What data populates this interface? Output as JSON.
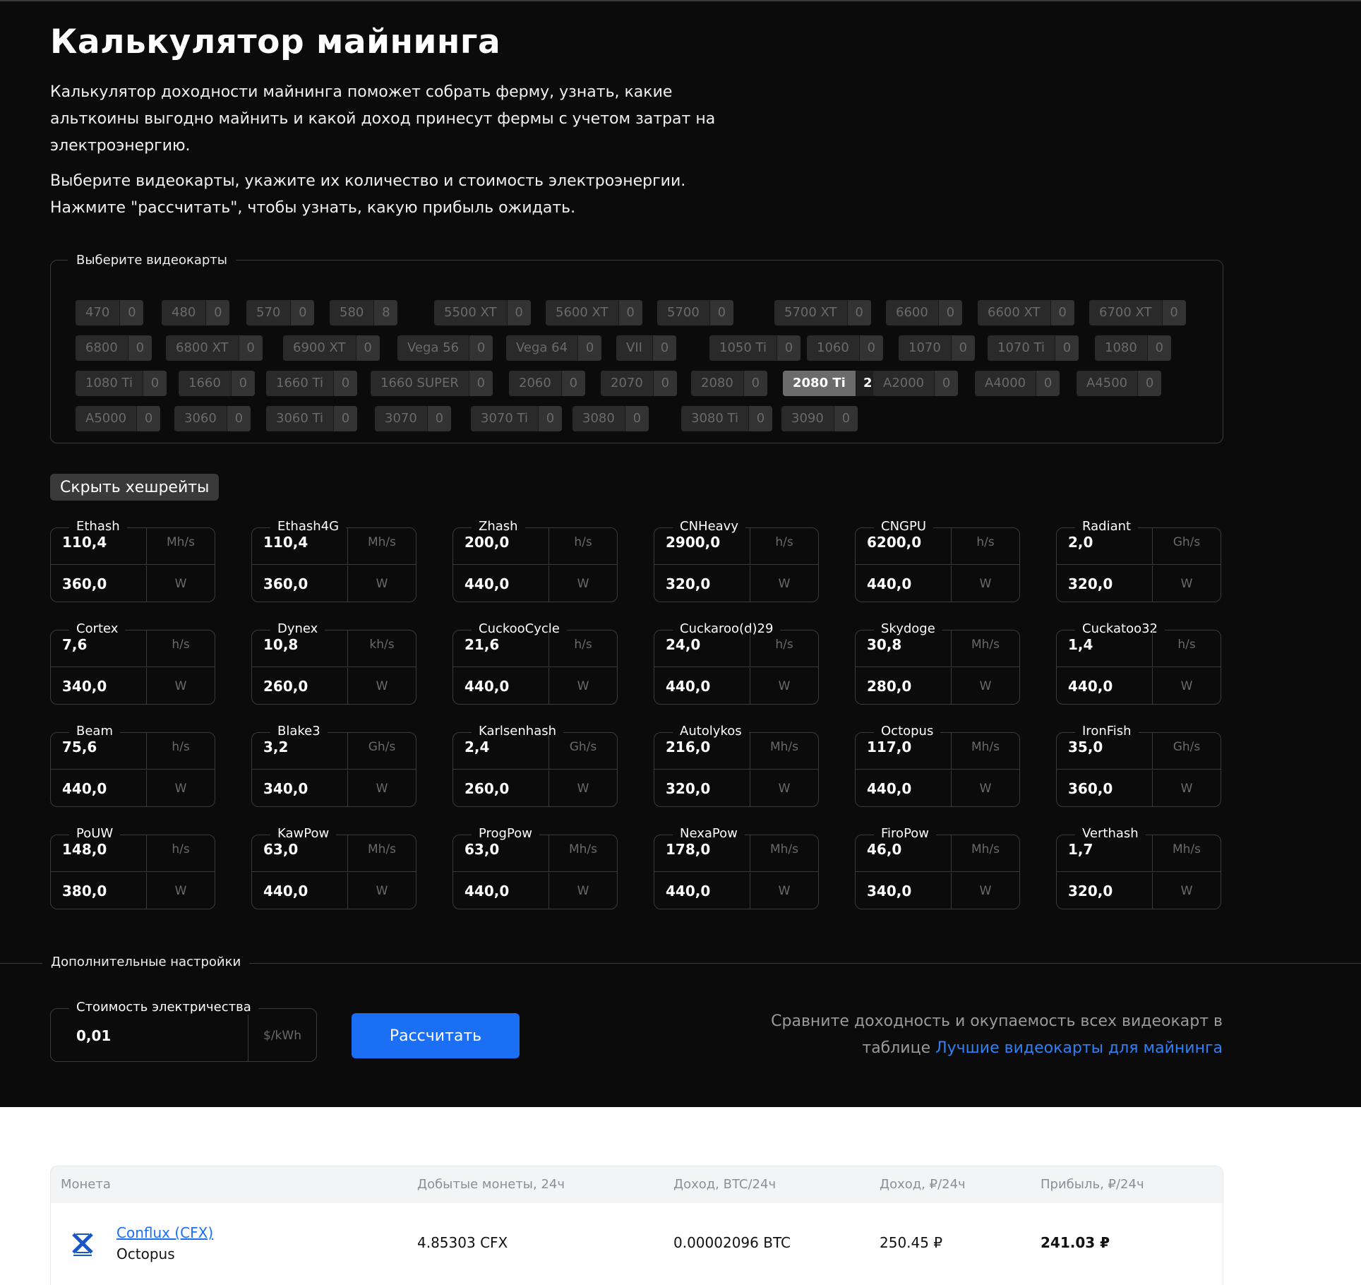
{
  "page": {
    "title": "Калькулятор майнинга",
    "intro_1": "Калькулятор доходности майнинга поможет собрать ферму, узнать, какие альткоины выгодно майнить и какой доход принесут фермы с учетом затрат на электроэнергию.",
    "intro_2": "Выберите видеокарты, укажите их количество и стоимость электроэнергии. Нажмите \"рассчитать\", чтобы узнать, какую прибыль ожидать."
  },
  "cards_section": {
    "legend": "Выберите видеокарты",
    "rows": [
      [
        [
          "470",
          "0"
        ],
        [
          "480",
          "0"
        ],
        [
          "570",
          "0"
        ],
        [
          "580",
          "8"
        ],
        [
          "5500 XT",
          "0"
        ],
        [
          "5600 XT",
          "0"
        ],
        [
          "5700",
          "0"
        ],
        [
          "5700 XT",
          "0"
        ],
        [
          "6600",
          "0"
        ],
        [
          "6600 XT",
          "0"
        ],
        [
          "6700 XT",
          "0"
        ]
      ],
      [
        [
          "6800",
          "0"
        ],
        [
          "6800 XT",
          "0"
        ],
        [
          "6900 XT",
          "0"
        ],
        [
          "Vega 56",
          "0"
        ],
        [
          "Vega 64",
          "0"
        ],
        [
          "VII",
          "0"
        ],
        [
          "1050 Ti",
          "0"
        ],
        [
          "1060",
          "0"
        ],
        [
          "1070",
          "0"
        ],
        [
          "1070 Ti",
          "0"
        ],
        [
          "1080",
          "0"
        ]
      ],
      [
        [
          "1080 Ti",
          "0"
        ],
        [
          "1660",
          "0"
        ],
        [
          "1660 Ti",
          "0"
        ],
        [
          "1660 SUPER",
          "0"
        ],
        [
          "2060",
          "0"
        ],
        [
          "2070",
          "0"
        ],
        [
          "2080",
          "0"
        ],
        [
          "2080 Ti",
          "2"
        ],
        [
          "A2000",
          "0"
        ],
        [
          "A4000",
          "0"
        ],
        [
          "A4500",
          "0"
        ]
      ],
      [
        [
          "A5000",
          "0"
        ],
        [
          "3060",
          "0"
        ],
        [
          "3060 Ti",
          "0"
        ],
        [
          "3070",
          "0"
        ],
        [
          "3070 Ti",
          "0"
        ],
        [
          "3080",
          "0"
        ],
        [
          "3080 Ti",
          "0"
        ],
        [
          "3090",
          "0"
        ]
      ]
    ],
    "active": "2080 Ti"
  },
  "hashrates": {
    "toggle_label": "Скрыть хешрейты",
    "items": [
      {
        "name": "Ethash",
        "hash": "110,4",
        "unit": "Mh/s",
        "power": "360,0",
        "punit": "W"
      },
      {
        "name": "Ethash4G",
        "hash": "110,4",
        "unit": "Mh/s",
        "power": "360,0",
        "punit": "W"
      },
      {
        "name": "Zhash",
        "hash": "200,0",
        "unit": "h/s",
        "power": "440,0",
        "punit": "W"
      },
      {
        "name": "CNHeavy",
        "hash": "2900,0",
        "unit": "h/s",
        "power": "320,0",
        "punit": "W"
      },
      {
        "name": "CNGPU",
        "hash": "6200,0",
        "unit": "h/s",
        "power": "440,0",
        "punit": "W"
      },
      {
        "name": "Radiant",
        "hash": "2,0",
        "unit": "Gh/s",
        "power": "320,0",
        "punit": "W"
      },
      {
        "name": "Cortex",
        "hash": "7,6",
        "unit": "h/s",
        "power": "340,0",
        "punit": "W"
      },
      {
        "name": "Dynex",
        "hash": "10,8",
        "unit": "kh/s",
        "power": "260,0",
        "punit": "W"
      },
      {
        "name": "CuckooCycle",
        "hash": "21,6",
        "unit": "h/s",
        "power": "440,0",
        "punit": "W"
      },
      {
        "name": "Cuckaroo(d)29",
        "hash": "24,0",
        "unit": "h/s",
        "power": "440,0",
        "punit": "W"
      },
      {
        "name": "Skydoge",
        "hash": "30,8",
        "unit": "Mh/s",
        "power": "280,0",
        "punit": "W"
      },
      {
        "name": "Cuckatoo32",
        "hash": "1,4",
        "unit": "h/s",
        "power": "440,0",
        "punit": "W"
      },
      {
        "name": "Beam",
        "hash": "75,6",
        "unit": "h/s",
        "power": "440,0",
        "punit": "W"
      },
      {
        "name": "Blake3",
        "hash": "3,2",
        "unit": "Gh/s",
        "power": "340,0",
        "punit": "W"
      },
      {
        "name": "Karlsenhash",
        "hash": "2,4",
        "unit": "Gh/s",
        "power": "260,0",
        "punit": "W"
      },
      {
        "name": "Autolykos",
        "hash": "216,0",
        "unit": "Mh/s",
        "power": "320,0",
        "punit": "W"
      },
      {
        "name": "Octopus",
        "hash": "117,0",
        "unit": "Mh/s",
        "power": "440,0",
        "punit": "W"
      },
      {
        "name": "IronFish",
        "hash": "35,0",
        "unit": "Gh/s",
        "power": "360,0",
        "punit": "W"
      },
      {
        "name": "PoUW",
        "hash": "148,0",
        "unit": "h/s",
        "power": "380,0",
        "punit": "W"
      },
      {
        "name": "KawPow",
        "hash": "63,0",
        "unit": "Mh/s",
        "power": "440,0",
        "punit": "W"
      },
      {
        "name": "ProgPow",
        "hash": "63,0",
        "unit": "Mh/s",
        "power": "440,0",
        "punit": "W"
      },
      {
        "name": "NexaPow",
        "hash": "178,0",
        "unit": "Mh/s",
        "power": "440,0",
        "punit": "W"
      },
      {
        "name": "FiroPow",
        "hash": "46,0",
        "unit": "Mh/s",
        "power": "340,0",
        "punit": "W"
      },
      {
        "name": "Verthash",
        "hash": "1,7",
        "unit": "Mh/s",
        "power": "320,0",
        "punit": "W"
      }
    ]
  },
  "settings": {
    "legend": "Дополнительные настройки",
    "electricity_label": "Стоимость электричества",
    "electricity_value": "0,01",
    "electricity_unit": "$/kWh",
    "calc_button": "Рассчитать",
    "compare_text": "Сравните доходность и окупаемость всех видеокарт в таблице",
    "compare_link": "Лучшие видеокарты для майнинга"
  },
  "results": {
    "headers": [
      "Монета",
      "Добытые монеты, 24ч",
      "Доход, BTC/24ч",
      "Доход, ₽/24ч",
      "Прибыль, ₽/24ч"
    ],
    "rows": [
      {
        "coin": "Conflux (CFX)",
        "algo": "Octopus",
        "mined": "4.85303 CFX",
        "btc": "0.00002096 BTC",
        "rub": "250.45 ₽",
        "profit": "241.03 ₽"
      }
    ]
  }
}
